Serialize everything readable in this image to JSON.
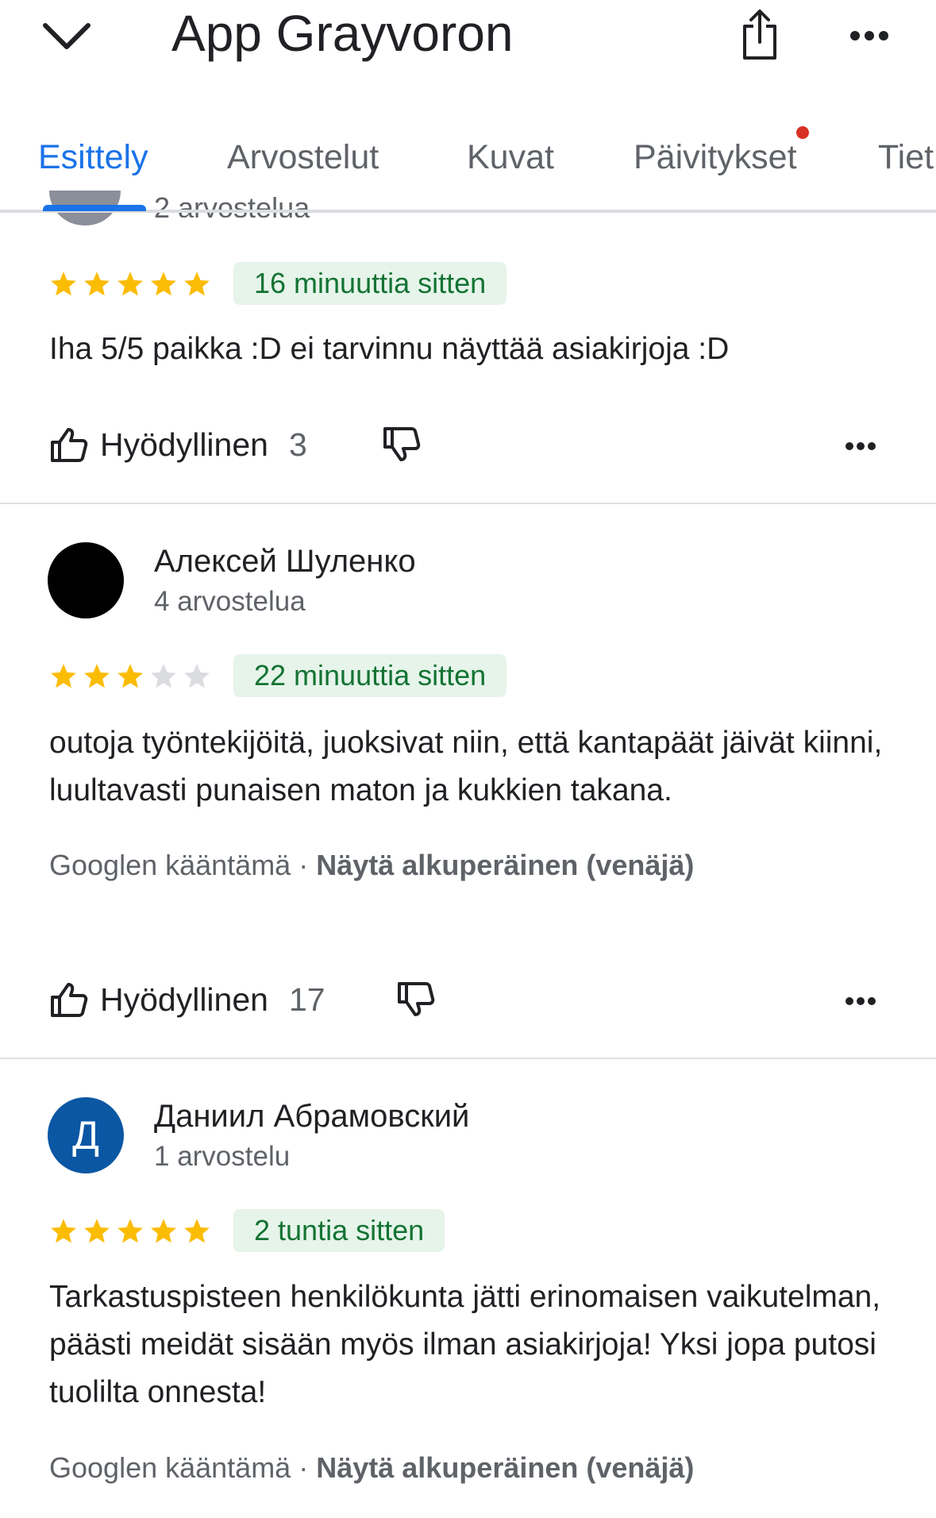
{
  "header": {
    "title": "App Grayvoron",
    "back_icon": "chevron-down-icon",
    "share_icon": "share-icon",
    "more_icon": "more-horizontal-icon"
  },
  "tabs": [
    {
      "label": "Esittely",
      "active": true
    },
    {
      "label": "Arvostelut",
      "active": false
    },
    {
      "label": "Kuvat",
      "active": false
    },
    {
      "label": "Päivitykset",
      "active": false,
      "notification": true
    },
    {
      "label": "Tiet",
      "active": false
    }
  ],
  "partial_review": {
    "reviews_count": "2 arvostelua",
    "rating": 5,
    "time": "16 minuuttia sitten",
    "text": "Iha 5/5 paikka :D ei tarvinnu näyttää asiakirjoja :D",
    "helpful_label": "Hyödyllinen",
    "helpful_count": "3"
  },
  "reviews": [
    {
      "author": "Алексей Шуленко",
      "reviews_count": "4 arvostelua",
      "avatar_color": "#000000",
      "avatar_letter": "",
      "rating": 3,
      "time": "22 minuuttia sitten",
      "text": "outoja työntekijöitä, juoksivat niin, että kantapäät jäivät kiinni, luultavasti punaisen maton ja kukkien takana.",
      "translated_label": "Googlen kääntämä",
      "separator": " · ",
      "show_original": "Näytä alkuperäinen (venäjä)",
      "helpful_label": "Hyödyllinen",
      "helpful_count": "17"
    },
    {
      "author": "Даниил Абрамовский",
      "reviews_count": "1 arvostelu",
      "avatar_color": "#0b57a4",
      "avatar_letter": "Д",
      "rating": 5,
      "time": "2 tuntia sitten",
      "text": "Tarkastuspisteen henkilökunta jätti erinomaisen vaikutelman, päästi meidät sisään myös ilman asiakirjoja! Yksi jopa putosi tuolilta onnesta!",
      "translated_label": "Googlen kääntämä",
      "separator": " · ",
      "show_original": "Näytä alkuperäinen (venäjä)"
    }
  ],
  "colors": {
    "accent": "#1a73e8",
    "star_filled": "#fbbc04",
    "star_empty": "#dadce0",
    "chip_bg": "#e6f4ea",
    "chip_text": "#137333",
    "notification": "#d93025"
  }
}
